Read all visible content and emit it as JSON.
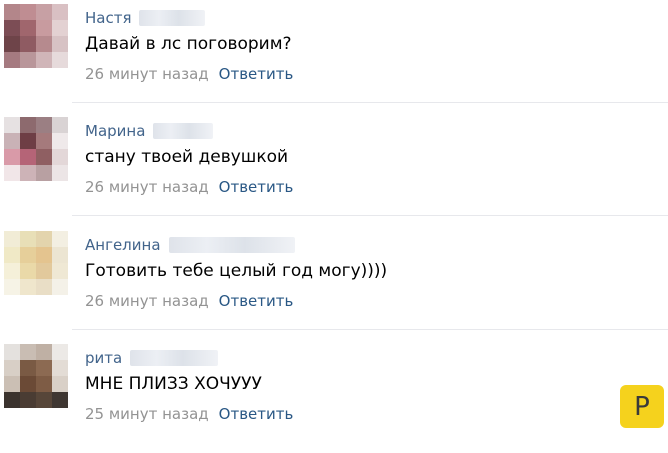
{
  "comments": [
    {
      "author": "Настя",
      "text": "Давай в лс поговорим?",
      "time": "26 минут назад",
      "reply_label": "Ответить",
      "avatar_tiles": [
        "#b3868a",
        "#bf8d92",
        "#c7a0a4",
        "#d9c0c3",
        "#7c4d55",
        "#a0666d",
        "#c89b9f",
        "#e3d1d2",
        "#6e4449",
        "#8f5b62",
        "#b68a8e",
        "#d7c2c4",
        "#a57a80",
        "#b9969a",
        "#d0b5b8",
        "#e6dadb"
      ]
    },
    {
      "author": "Марина",
      "text": "стану твоей девушкой",
      "time": "26 минут назад",
      "reply_label": "Ответить",
      "avatar_tiles": [
        "#e6e1e2",
        "#8d6a6e",
        "#9b7f83",
        "#d9d3d4",
        "#c9b2b6",
        "#6e3e45",
        "#a57a7c",
        "#efe9ea",
        "#d99aa8",
        "#b56477",
        "#8f5f62",
        "#e3d7d8",
        "#f1e6e8",
        "#cdb3b7",
        "#b8a0a2",
        "#ece5e6"
      ]
    },
    {
      "author": "Ангелина",
      "text": "Готовить тебе целый год могу))))",
      "time": "26 минут назад",
      "reply_label": "Ответить",
      "avatar_tiles": [
        "#f1ecd6",
        "#e8dfb7",
        "#e3d4ad",
        "#f3efe2",
        "#f0e9c6",
        "#e6cf9a",
        "#e4c48f",
        "#ece5d2",
        "#f5f0d9",
        "#ead9a8",
        "#e2c99c",
        "#efe8d4",
        "#f6f3e6",
        "#efe6cc",
        "#e9dec6",
        "#f4f1e8"
      ]
    },
    {
      "author": "рита",
      "text": "МНЕ ПЛИЗЗ ХОЧУУУ",
      "time": "25 минут назад",
      "reply_label": "Ответить",
      "avatar_tiles": [
        "#e4e1de",
        "#c9bdb3",
        "#bfb0a4",
        "#ece9e6",
        "#d8cfc6",
        "#7a5a44",
        "#8c6a52",
        "#e3dcd5",
        "#cbbfb4",
        "#6b4a36",
        "#7e5c45",
        "#d9d0c7",
        "#3b332e",
        "#4a3c33",
        "#574639",
        "#3f3732"
      ]
    }
  ],
  "badge": {
    "label": "P",
    "color": "#f5d21d"
  }
}
